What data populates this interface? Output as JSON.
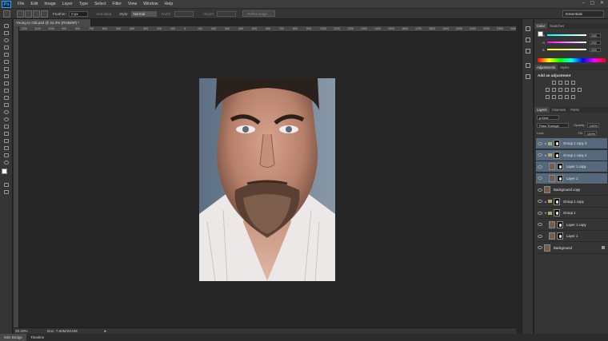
{
  "app": {
    "logo": "Ps",
    "menu": [
      "File",
      "Edit",
      "Image",
      "Layer",
      "Type",
      "Select",
      "Filter",
      "View",
      "Window",
      "Help"
    ],
    "window_controls": [
      "–",
      "▢",
      "✕"
    ]
  },
  "options_bar": {
    "feather_label": "Feather:",
    "feather_value": "0 px",
    "anti_alias_label": "Anti-alias",
    "style_label": "Style:",
    "style_value": "Normal",
    "width_label": "Width:",
    "height_label": "Height:",
    "refine_edge_label": "Refine Edge...",
    "workspace": "Essentials"
  },
  "document": {
    "tab_title": "Young to Old.psd @ 33.3% (RGB/8#) *",
    "zoom": "33.33%",
    "doc_info": "Doc: 7.60M/28.8M",
    "ruler_ticks": [
      "1200",
      "1100",
      "1000",
      "900",
      "800",
      "700",
      "600",
      "500",
      "400",
      "300",
      "200",
      "100",
      "0",
      "100",
      "200",
      "300",
      "400",
      "500",
      "600",
      "700",
      "800",
      "900",
      "1000",
      "1100",
      "1200",
      "1300",
      "1400",
      "1500",
      "1600",
      "1700",
      "1800",
      "1900",
      "2000",
      "2100",
      "2200",
      "2300",
      "2400"
    ]
  },
  "bottom_tabs": [
    "Mini Bridge",
    "Timeline"
  ],
  "color_panel": {
    "tabs": [
      "Color",
      "Swatches"
    ],
    "channels": [
      {
        "label": "R",
        "value": "255",
        "color": "#e04040"
      },
      {
        "label": "G",
        "value": "255",
        "color": "#40c040"
      },
      {
        "label": "B",
        "value": "255",
        "color": "#4060e0"
      }
    ]
  },
  "adjustments_panel": {
    "tabs": [
      "Adjustments",
      "Styles"
    ],
    "title": "Add an adjustment"
  },
  "layers_panel": {
    "tabs": [
      "Layers",
      "Channels",
      "Paths"
    ],
    "filter": "ρ Kind",
    "blend_mode": "Pass Through",
    "opacity_label": "Opacity:",
    "opacity_value": "100%",
    "lock_label": "Lock:",
    "fill_label": "Fill:",
    "fill_value": "100%",
    "layers": [
      {
        "name": "Group 1 copy 3",
        "kind": "group",
        "selected": true,
        "expanded": false,
        "indent": 0
      },
      {
        "name": "Group 1 copy 2",
        "kind": "group",
        "selected": true,
        "expanded": true,
        "indent": 0
      },
      {
        "name": "Layer 1 copy",
        "kind": "layer",
        "selected": true,
        "indent": 1
      },
      {
        "name": "Layer 1",
        "kind": "layer",
        "selected": true,
        "indent": 1
      },
      {
        "name": "Background copy",
        "kind": "pixel",
        "selected": false,
        "indent": 0
      },
      {
        "name": "Group 1 copy",
        "kind": "group",
        "selected": false,
        "expanded": false,
        "indent": 0
      },
      {
        "name": "Group 1",
        "kind": "group",
        "selected": false,
        "expanded": true,
        "indent": 0
      },
      {
        "name": "Layer 1 copy",
        "kind": "layer",
        "selected": false,
        "indent": 1
      },
      {
        "name": "Layer 1",
        "kind": "layer",
        "selected": false,
        "indent": 1
      },
      {
        "name": "Background",
        "kind": "background",
        "selected": false,
        "indent": 0
      }
    ]
  }
}
